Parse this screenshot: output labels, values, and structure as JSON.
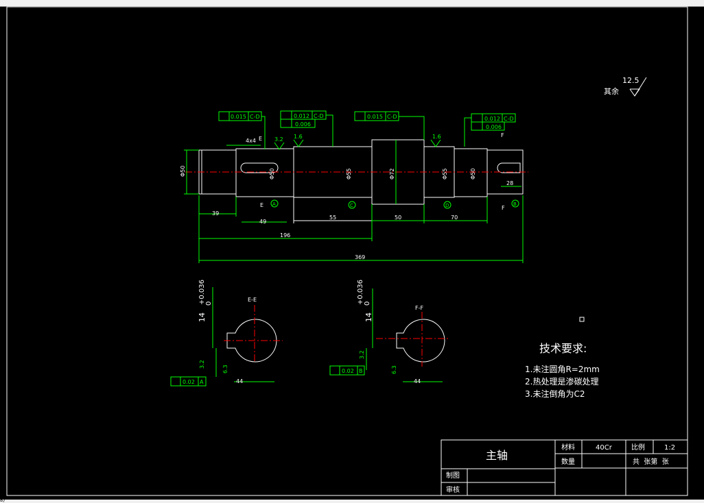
{
  "window": {
    "status_glyph": "8/"
  },
  "roughness": {
    "value": "12.5",
    "label": "其余"
  },
  "tolerances": {
    "runout_1": "0.015",
    "datum_1": "C-D",
    "runout_2": "0.012",
    "datum_2": "C-D",
    "cyl_2": "0.006",
    "runout_3": "0.015",
    "datum_3": "C-D",
    "runout_4": "0.012",
    "datum_4": "C-D",
    "cyl_4": "0.006",
    "sym_A": "0.02",
    "datum_A": "A",
    "sym_B": "0.02",
    "datum_B": "B"
  },
  "surface_marks": {
    "m1": "3.2",
    "m2": "1.6",
    "m3": "1.6",
    "m4": "3.2",
    "m5": "6.3",
    "m6": "3.2",
    "m7": "6.3"
  },
  "dimensions": {
    "key_left": "4x4",
    "dia_left": "Φ50",
    "dia_journal_left": "Φ50",
    "dia_mid": "Φ55",
    "dia_collar": "Φ72",
    "dia_right55": "Φ55",
    "dia_right50": "Φ50",
    "len_39": "39",
    "len_49": "49",
    "len_55": "55",
    "len_50": "50",
    "len_70": "70",
    "len_196": "196",
    "len_369": "369",
    "len_28": "28"
  },
  "sections": {
    "E": {
      "title": "E-E",
      "width": "14",
      "tol_up": "+0.036",
      "tol_low": "0",
      "depth": "44",
      "cut_left": "E",
      "cut_right": "E"
    },
    "F": {
      "title": "F-F",
      "width": "14",
      "tol_up": "+0.036",
      "tol_low": "0",
      "depth": "44",
      "cut_left": "F",
      "cut_right": "F"
    }
  },
  "datums": {
    "A": "A",
    "C": "C",
    "B": "B",
    "D": "D"
  },
  "tech": {
    "title": "技术要求:",
    "items": [
      "1.未注圆角R=2mm",
      "2.热处理是渗碳处理",
      "3.未注倒角为C2"
    ]
  },
  "title_block": {
    "part_name": "主轴",
    "material_label": "材料",
    "material": "40Cr",
    "scale_label": "比例",
    "scale": "1:2",
    "qty_label": "数量",
    "sheets": "共  张第  张",
    "drawn_label": "制图",
    "checked_label": "审核"
  }
}
